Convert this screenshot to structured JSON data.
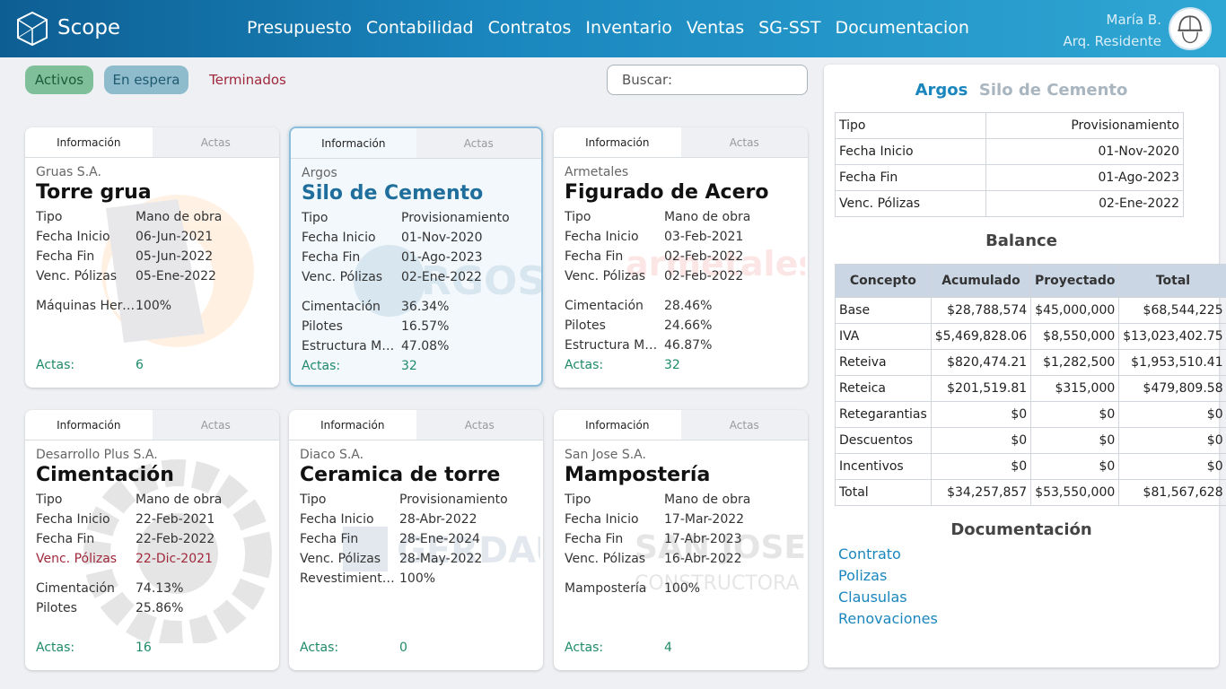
{
  "app": {
    "brand": "Scope"
  },
  "nav": [
    "Presupuesto",
    "Contabilidad",
    "Contratos",
    "Inventario",
    "Ventas",
    "SG-SST",
    "Documentacion"
  ],
  "user": {
    "name": "María B.",
    "role": "Arq. Residente"
  },
  "filters": {
    "activos": "Activos",
    "en_espera": "En espera",
    "terminados": "Terminados"
  },
  "search": {
    "placeholder": "Buscar:"
  },
  "cards": [
    {
      "tab_info": "Información",
      "tab_actas": "Actas",
      "company": "Gruas S.A.",
      "title": "Torre grua",
      "tipo_label": "Tipo",
      "tipo": "Mano de obra",
      "inicio_label": "Fecha Inicio",
      "inicio": "06-Jun-2021",
      "fin_label": "Fecha Fin",
      "fin": "05-Jun-2022",
      "venc_label": "Venc. Pólizas",
      "venc": "05-Ene-2022",
      "items": [
        {
          "label": "Máquinas Herramientas",
          "value": "100%"
        }
      ],
      "actas_label": "Actas:",
      "actas": "6"
    },
    {
      "tab_info": "Información",
      "tab_actas": "Actas",
      "company": "Argos",
      "title": "Silo de Cemento",
      "tipo_label": "Tipo",
      "tipo": "Provisionamiento",
      "inicio_label": "Fecha Inicio",
      "inicio": "01-Nov-2020",
      "fin_label": "Fecha Fin",
      "fin": "01-Ago-2023",
      "venc_label": "Venc. Pólizas",
      "venc": "02-Ene-2022",
      "items": [
        {
          "label": "Cimentación",
          "value": "36.34%"
        },
        {
          "label": "Pilotes",
          "value": "16.57%"
        },
        {
          "label": "Estructura Metálica",
          "value": "47.08%"
        }
      ],
      "actas_label": "Actas:",
      "actas": "32"
    },
    {
      "tab_info": "Información",
      "tab_actas": "Actas",
      "company": "Armetales",
      "title": "Figurado de Acero",
      "tipo_label": "Tipo",
      "tipo": "Mano de obra",
      "inicio_label": "Fecha Inicio",
      "inicio": "03-Feb-2021",
      "fin_label": "Fecha Fin",
      "fin": "02-Feb-2022",
      "venc_label": "Venc. Pólizas",
      "venc": "02-Feb-2022",
      "items": [
        {
          "label": "Cimentación",
          "value": "28.46%"
        },
        {
          "label": "Pilotes",
          "value": "24.66%"
        },
        {
          "label": "Estructura Metálica",
          "value": "46.87%"
        }
      ],
      "actas_label": "Actas:",
      "actas": "32"
    },
    {
      "tab_info": "Información",
      "tab_actas": "Actas",
      "company": "Desarrollo Plus S.A.",
      "title": "Cimentación",
      "tipo_label": "Tipo",
      "tipo": "Mano de obra",
      "inicio_label": "Fecha Inicio",
      "inicio": "22-Feb-2021",
      "fin_label": "Fecha Fin",
      "fin": "22-Feb-2022",
      "venc_label": "Venc. Pólizas",
      "venc": "22-Dic-2021",
      "items": [
        {
          "label": "Cimentación",
          "value": "74.13%"
        },
        {
          "label": "Pilotes",
          "value": "25.86%"
        }
      ],
      "actas_label": "Actas:",
      "actas": "16"
    },
    {
      "tab_info": "Información",
      "tab_actas": "Actas",
      "company": "Diaco S.A.",
      "title": "Ceramica de torre",
      "tipo_label": "Tipo",
      "tipo": "Provisionamiento",
      "inicio_label": "Fecha Inicio",
      "inicio": "28-Abr-2022",
      "fin_label": "Fecha Fin",
      "fin": "28-Ene-2024",
      "venc_label": "Venc. Pólizas",
      "venc": "28-May-2022",
      "items": [
        {
          "label": "Revestimiento cerámico",
          "value": "100%"
        }
      ],
      "actas_label": "Actas:",
      "actas": "0"
    },
    {
      "tab_info": "Información",
      "tab_actas": "Actas",
      "company": "San Jose S.A.",
      "title": "Mampostería",
      "tipo_label": "Tipo",
      "tipo": "Mano de obra",
      "inicio_label": "Fecha Inicio",
      "inicio": "17-Mar-2022",
      "fin_label": "Fecha Fin",
      "fin": "17-Abr-2023",
      "venc_label": "Venc. Pólizas",
      "venc": "16-Abr-2022",
      "items": [
        {
          "label": "Mampostería",
          "value": "100%"
        }
      ],
      "actas_label": "Actas:",
      "actas": "4"
    }
  ],
  "panel": {
    "company": "Argos",
    "project": "Silo de Cemento",
    "info": [
      {
        "label": "Tipo",
        "value": "Provisionamiento"
      },
      {
        "label": "Fecha Inicio",
        "value": "01-Nov-2020"
      },
      {
        "label": "Fecha Fin",
        "value": "01-Ago-2023"
      },
      {
        "label": "Venc. Pólizas",
        "value": "02-Ene-2022"
      }
    ],
    "balance_title": "Balance",
    "balance_headers": [
      "Concepto",
      "Acumulado",
      "Proyectado",
      "Total"
    ],
    "balance_rows": [
      [
        "Base",
        "$28,788,574",
        "$45,000,000",
        "$68,544,225"
      ],
      [
        "IVA",
        "$5,469,828.06",
        "$8,550,000",
        "$13,023,402.75"
      ],
      [
        "Reteiva",
        "$820,474.21",
        "$1,282,500",
        "$1,953,510.41"
      ],
      [
        "Reteica",
        "$201,519.81",
        "$315,000",
        "$479,809.58"
      ],
      [
        "Retegarantias",
        "$0",
        "$0",
        "$0"
      ],
      [
        "Descuentos",
        "$0",
        "$0",
        "$0"
      ],
      [
        "Incentivos",
        "$0",
        "$0",
        "$0"
      ],
      [
        "Total",
        "$34,257,857",
        "$53,550,000",
        "$81,567,628"
      ]
    ],
    "docs_title": "Documentación",
    "docs": [
      "Contrato",
      "Polizas",
      "Clausulas",
      "Renovaciones"
    ]
  },
  "colors": {
    "accent": "#1a86bd",
    "warning": "#a0283c",
    "actas": "#1f8a6a",
    "active_filter": "#7fc09b",
    "waiting_filter": "#8fbccc"
  }
}
